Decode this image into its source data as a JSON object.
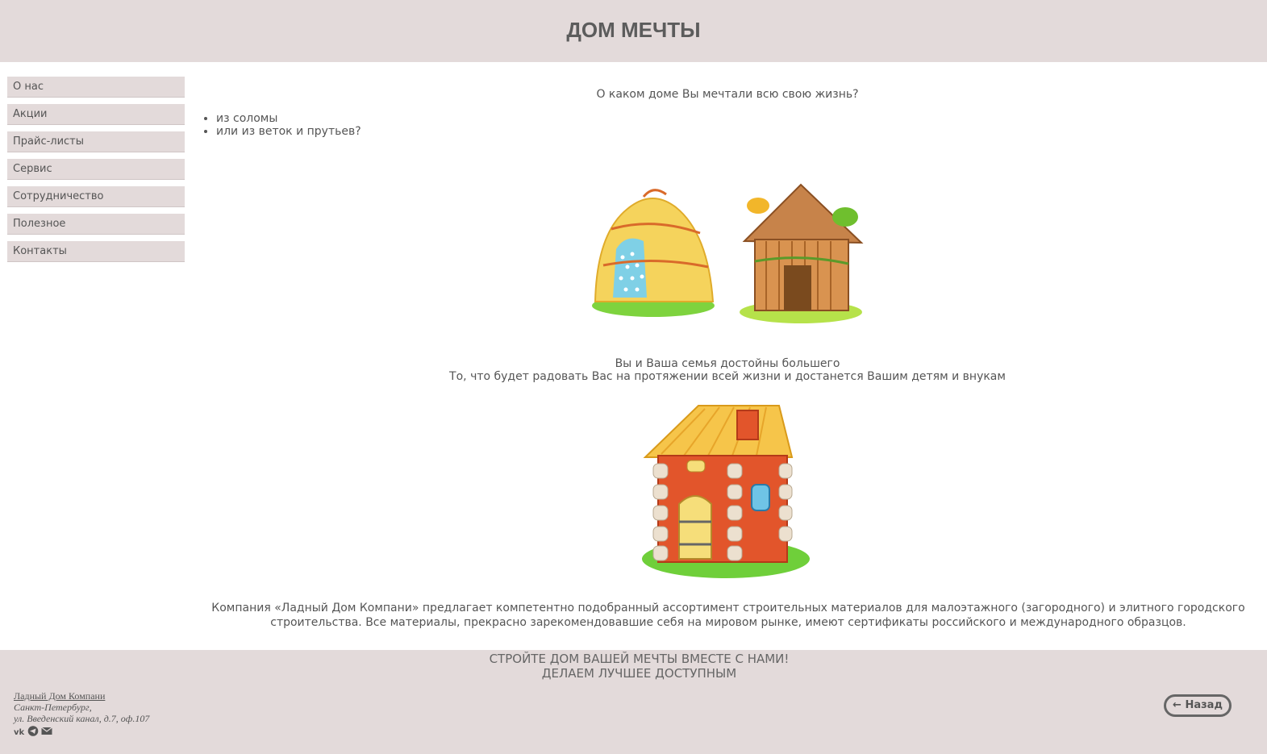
{
  "header": {
    "title": "ДОМ МЕЧТЫ"
  },
  "nav": {
    "items": [
      {
        "label": "О нас"
      },
      {
        "label": "Акции"
      },
      {
        "label": "Прайс-листы"
      },
      {
        "label": "Сервис"
      },
      {
        "label": "Сотрудничество"
      },
      {
        "label": "Полезное"
      },
      {
        "label": "Контакты"
      }
    ]
  },
  "main": {
    "question": "О каком доме Вы мечтали всю свою жизнь?",
    "options": [
      "из соломы",
      "или из веток и прутьев?"
    ],
    "caption_line1": "Вы и Ваша семья достойны большего",
    "caption_line2": "То, что будет радовать Вас на протяжении всей жизни и достанется Вашим детям и внукам",
    "about": "Компания «Ладный Дом Компани» предлагает компетентно подобранный ассортимент строительных материалов для малоэтажного (загородного) и элитного городского строительства. Все материалы, прекрасно зарекомендовавшие себя на мировом рынке, имеют сертификаты российского и международного образцов."
  },
  "footer": {
    "slogan_line1": "СТРОЙТЕ ДОМ ВАШЕЙ МЕЧТЫ ВМЕСТЕ С НАМИ!",
    "slogan_line2": "ДЕЛАЕМ ЛУЧШЕЕ ДОСТУПНЫМ",
    "company_name": "Ладный Дом Компани",
    "city": "Санкт-Петербург,",
    "address": "ул. Введенский канал, д.7, оф.107",
    "socials": [
      "vk-icon",
      "telegram-icon",
      "email-icon"
    ],
    "back_label": "← Назад"
  },
  "colors": {
    "panel_bg": "#e3dada",
    "text": "#555555",
    "straw": "#f3d25a",
    "brick": "#e2552b",
    "grass": "#6fcf3a"
  }
}
